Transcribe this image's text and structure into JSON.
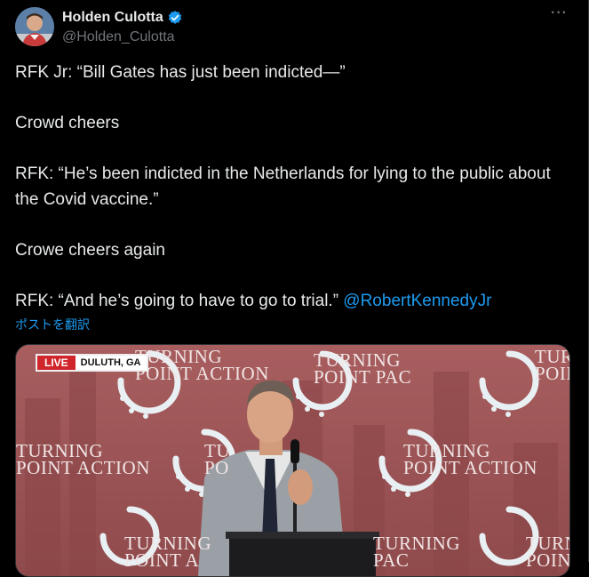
{
  "author": {
    "display_name": "Holden Culotta",
    "handle": "@Holden_Culotta"
  },
  "more_label": "···",
  "tweet": {
    "line1": "RFK Jr: “Bill Gates has just been indicted—”",
    "line2": "Crowd cheers",
    "line3": "RFK: “He’s been indicted in the Netherlands for lying to the public about the Covid vaccine.”",
    "line4": "Crowe cheers again",
    "line5": "RFK: “And he’s going to have to go to trial.”",
    "mention": "@RobertKennedyJr"
  },
  "translate_label": "ポストを翻訳",
  "media": {
    "live_label": "LIVE",
    "location_label": "DULUTH, GA",
    "backdrop_texts": [
      {
        "top": "TURNING",
        "bottom": "POINT ACTION"
      },
      {
        "top": "TURNING",
        "bottom": "POINT PAC"
      },
      {
        "top": "TURN",
        "bottom": "POINT"
      },
      {
        "top": "TURNING",
        "bottom": "POINT ACTION"
      },
      {
        "top": "TU",
        "bottom": "PO"
      },
      {
        "top": "TURNING",
        "bottom": "POINT ACTION"
      },
      {
        "top": "TURNING",
        "bottom": "POINT A"
      },
      {
        "top": "TURNING",
        "bottom": "PAC"
      },
      {
        "top": "TURN",
        "bottom": "POINT"
      }
    ]
  },
  "colors": {
    "background": "#000000",
    "text": "#e7e9ea",
    "secondary": "#71767b",
    "link": "#1d9bf0",
    "verified": "#1d9bf0",
    "live_red": "#d0262b",
    "backdrop": "#9c5556"
  }
}
